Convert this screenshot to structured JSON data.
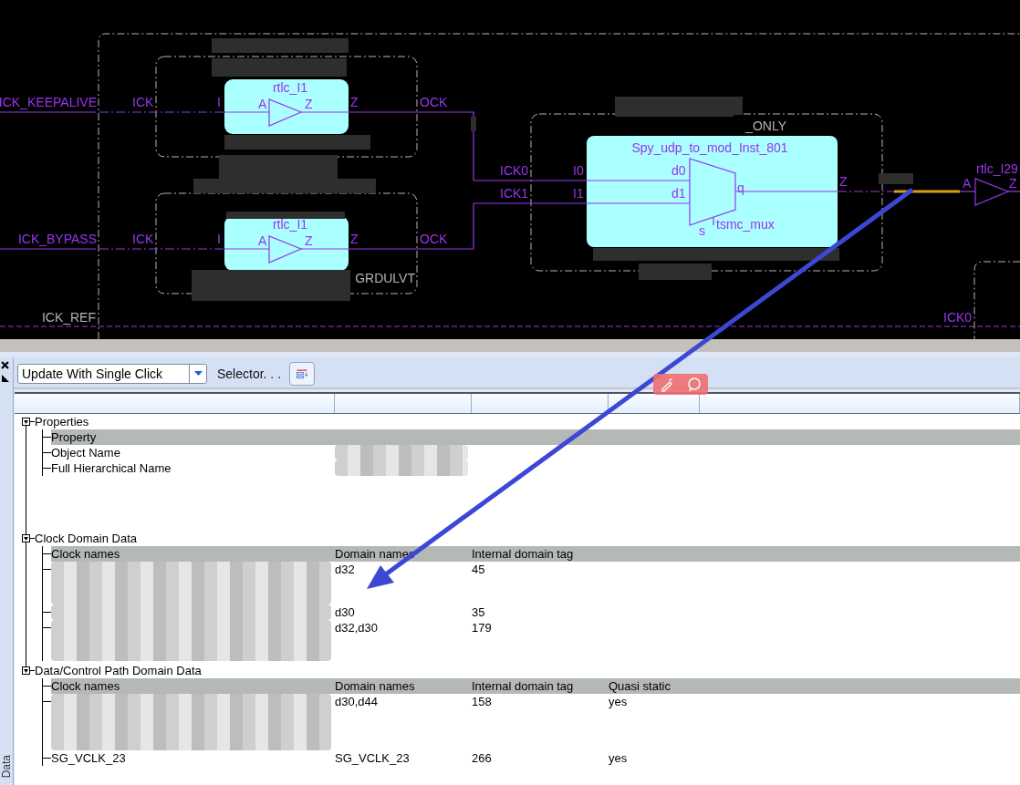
{
  "schematic": {
    "inputs": [
      {
        "net": "ICK_KEEPALIVE",
        "port_in": "ICK",
        "pin_in": "I",
        "instance": "rtlc_I1",
        "cell_in": "A",
        "cell_out": "Z",
        "pin_out": "Z",
        "port_out": "OCK"
      },
      {
        "net": "ICK_BYPASS",
        "port_in": "ICK",
        "pin_in": "I",
        "instance": "rtlc_I1",
        "cell_in": "A",
        "cell_out": "Z",
        "pin_out": "Z",
        "port_out": "OCK",
        "cell_label": "GRDULVT"
      }
    ],
    "mux": {
      "module_label": "_ONLY",
      "instance": "Spy_udp_to_mod_Inst_801",
      "ports_in": [
        {
          "net": "ICK0",
          "pin": "I0",
          "cell_pin": "d0"
        },
        {
          "net": "ICK1",
          "pin": "I1",
          "cell_pin": "d1"
        }
      ],
      "cell_out": "q",
      "select": "s",
      "cell": "tsmc_mux",
      "pin_out": "Z"
    },
    "output": {
      "instance": "rtlc_I29",
      "cell_in": "A",
      "cell_out": "Z",
      "highlighted": true
    },
    "ref_net": "ICK_REF",
    "right_port": "ICK0"
  },
  "toolbar": {
    "dropdown": "Update With Single Click",
    "selector": "Selector. . ."
  },
  "side_tab": "Data",
  "table": {
    "sections": [
      {
        "title": "Properties",
        "expanded": true,
        "header": [
          "Property"
        ],
        "rows": [
          [
            "Object Name",
            null
          ],
          [
            "Full Hierarchical Name",
            null
          ]
        ]
      },
      {
        "title": "Clock Domain Data",
        "expanded": true,
        "header": [
          "Clock names",
          "Domain names",
          "Internal domain tag"
        ],
        "rows": [
          [
            null,
            "d32",
            "45"
          ],
          [
            null,
            "d30",
            "35"
          ],
          [
            null,
            "d32,d30",
            "179"
          ]
        ]
      },
      {
        "title": "Data/Control Path Domain Data",
        "expanded": true,
        "header": [
          "Clock names",
          "Domain names",
          "Internal domain tag",
          "Quasi static"
        ],
        "rows": [
          [
            null,
            "d30,d44",
            "158",
            "yes"
          ],
          [
            "SG_VCLK_23",
            "SG_VCLK_23",
            "266",
            "yes"
          ]
        ]
      }
    ]
  }
}
